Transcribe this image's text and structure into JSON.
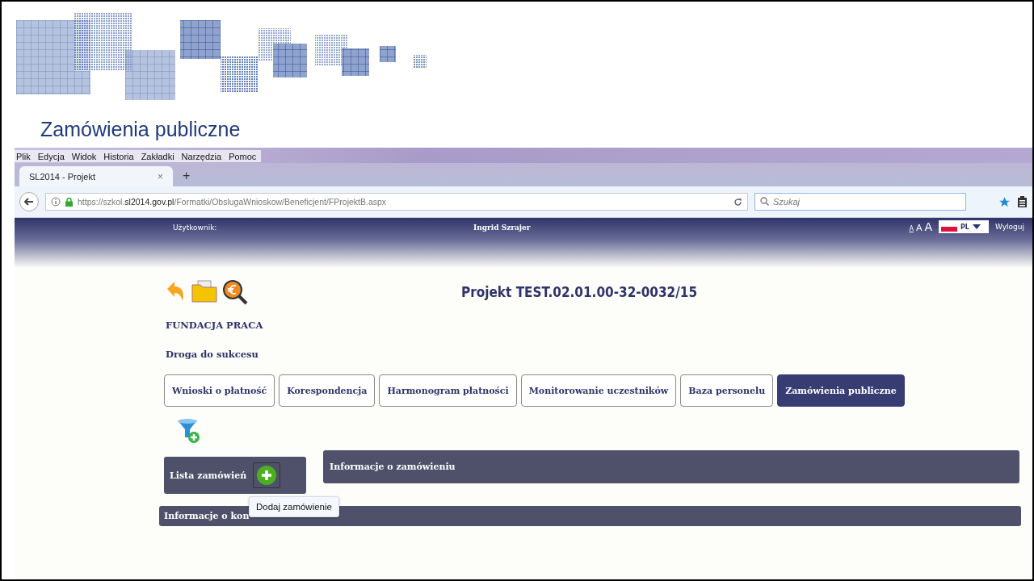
{
  "slide": {
    "title": "Zamówienia publiczne"
  },
  "browser": {
    "menu": [
      "Plik",
      "Edycja",
      "Widok",
      "Historia",
      "Zakładki",
      "Narzędzia",
      "Pomoc"
    ],
    "tab": {
      "title": "SL2014 - Projekt",
      "close": "×"
    },
    "new_tab": "+",
    "url": "https://szkol.**sl2014.gov.pl**/Formatki/ObslugaWnioskow/Beneficjent/FProjektB.aspx",
    "search": {
      "placeholder": "Szukaj"
    }
  },
  "app": {
    "user_label": "Użytkownik:",
    "user_name": "Ingrid Szrajer",
    "font_sizes": [
      "A",
      "A",
      "A"
    ],
    "language": "PL",
    "logout": "Wyloguj",
    "project_title": "Projekt TEST.02.01.00-32-0032/15",
    "organization": "FUNDACJA PRACA",
    "project_name": "Droga do sukcesu",
    "tabs": [
      {
        "label": "Wnioski o płatność",
        "selected": false
      },
      {
        "label": "Korespondencja",
        "selected": false
      },
      {
        "label": "Harmonogram płatności",
        "selected": false
      },
      {
        "label": "Monitorowanie uczestników",
        "selected": false
      },
      {
        "label": "Baza personelu",
        "selected": false
      },
      {
        "label": "Zamówienia publiczne",
        "selected": true
      }
    ],
    "list_panel": {
      "title": "Lista zamówień"
    },
    "details_panel": {
      "title": "Informacje o zamówieniu"
    },
    "contract_panel": {
      "title": "Informacje o kon"
    },
    "tooltip": "Dodaj zamówienie"
  }
}
